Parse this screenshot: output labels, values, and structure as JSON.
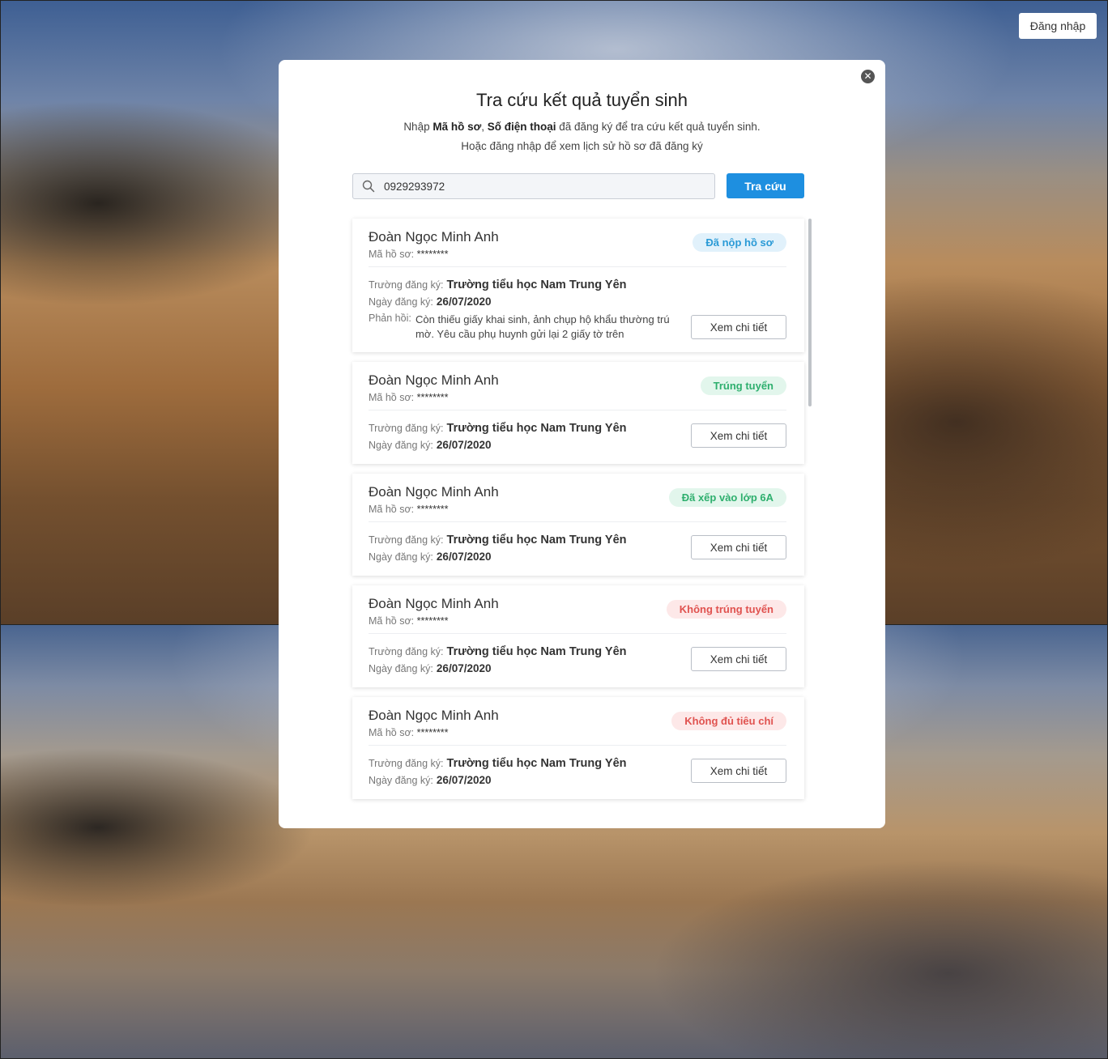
{
  "header": {
    "login_label": "Đăng nhập"
  },
  "modal": {
    "title": "Tra cứu kết quả tuyển sinh",
    "subtitle_prefix": "Nhập ",
    "subtitle_bold1": "Mã hồ sơ",
    "subtitle_sep": ", ",
    "subtitle_bold2": "Số điện thoại",
    "subtitle_suffix": " đã đăng ký để tra cứu kết quả tuyển sinh.",
    "subtitle_line2": "Hoặc đăng nhập để xem lịch sử hồ sơ đã đăng ký",
    "close_icon": "close-icon"
  },
  "search": {
    "value": "0929293972",
    "button_label": "Tra cứu",
    "icon": "search-icon"
  },
  "labels": {
    "code": "Mã hồ sơ:",
    "school": "Trường đăng ký:",
    "date": "Ngày đăng ký:",
    "feedback": "Phản hồi:",
    "detail": "Xem chi tiết"
  },
  "colors": {
    "accent": "#1e8fe0",
    "status_blue": "#2a9ad6",
    "status_green": "#2eaf6e",
    "status_red": "#e0524f"
  },
  "records": [
    {
      "name": "Đoàn Ngọc Minh Anh",
      "code": "********",
      "status": "Đã nộp hồ sơ",
      "status_color": "blue",
      "school": "Trường tiểu học Nam Trung Yên",
      "date": "26/07/2020",
      "feedback": "Còn thiếu giấy khai sinh, ảnh chụp hộ khẩu thường trú mờ. Yêu cầu phụ huynh gửi lại 2 giấy tờ trên"
    },
    {
      "name": "Đoàn Ngọc Minh Anh",
      "code": "********",
      "status": "Trúng tuyển",
      "status_color": "green",
      "school": "Trường tiểu học Nam Trung Yên",
      "date": "26/07/2020"
    },
    {
      "name": "Đoàn Ngọc Minh Anh",
      "code": "********",
      "status": "Đã xếp vào lớp 6A",
      "status_color": "green",
      "school": "Trường tiểu học Nam Trung Yên",
      "date": "26/07/2020"
    },
    {
      "name": "Đoàn Ngọc Minh Anh",
      "code": "********",
      "status": "Không trúng tuyển",
      "status_color": "red",
      "school": "Trường tiểu học Nam Trung Yên",
      "date": "26/07/2020"
    },
    {
      "name": "Đoàn Ngọc Minh Anh",
      "code": "********",
      "status": "Không đủ tiêu chí",
      "status_color": "red",
      "school": "Trường tiểu học Nam Trung Yên",
      "date": "26/07/2020"
    }
  ]
}
